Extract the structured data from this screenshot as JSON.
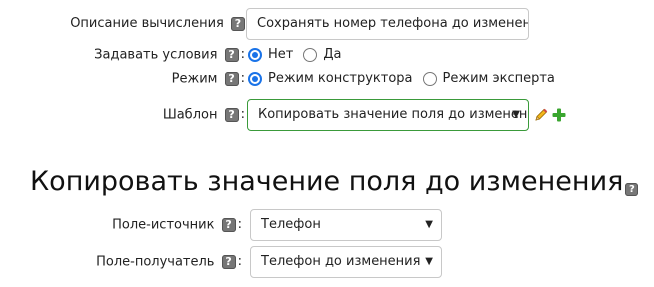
{
  "form": {
    "description": {
      "label": "Описание вычисления",
      "help": "?",
      "value": "Сохранять номер телефона до изменения"
    },
    "conditions": {
      "label": "Задавать условия",
      "help": "?",
      "colon": ":",
      "options": [
        "Нет",
        "Да"
      ],
      "selected": "Нет"
    },
    "mode": {
      "label": "Режим",
      "help": "?",
      "colon": ":",
      "options": [
        "Режим конструктора",
        "Режим эксперта"
      ],
      "selected": "Режим конструктора"
    },
    "template": {
      "label": "Шаблон",
      "help": "?",
      "colon": ":",
      "value": "Копировать значение поля до изменения"
    }
  },
  "section": {
    "title": "Копировать значение поля до изменения",
    "help": "?",
    "source": {
      "label": "Поле-источник",
      "help": "?",
      "colon": ":",
      "value": "Телефон"
    },
    "target": {
      "label": "Поле-получатель",
      "help": "?",
      "colon": ":",
      "value": "Телефон до изменения"
    }
  },
  "icons": {
    "edit": "pencil-icon",
    "add": "plus-icon",
    "dropdown": "chevron-down-icon"
  },
  "colors": {
    "accent": "#1a73e8",
    "add": "#3aa62f",
    "template_border": "#3a9a3a"
  }
}
